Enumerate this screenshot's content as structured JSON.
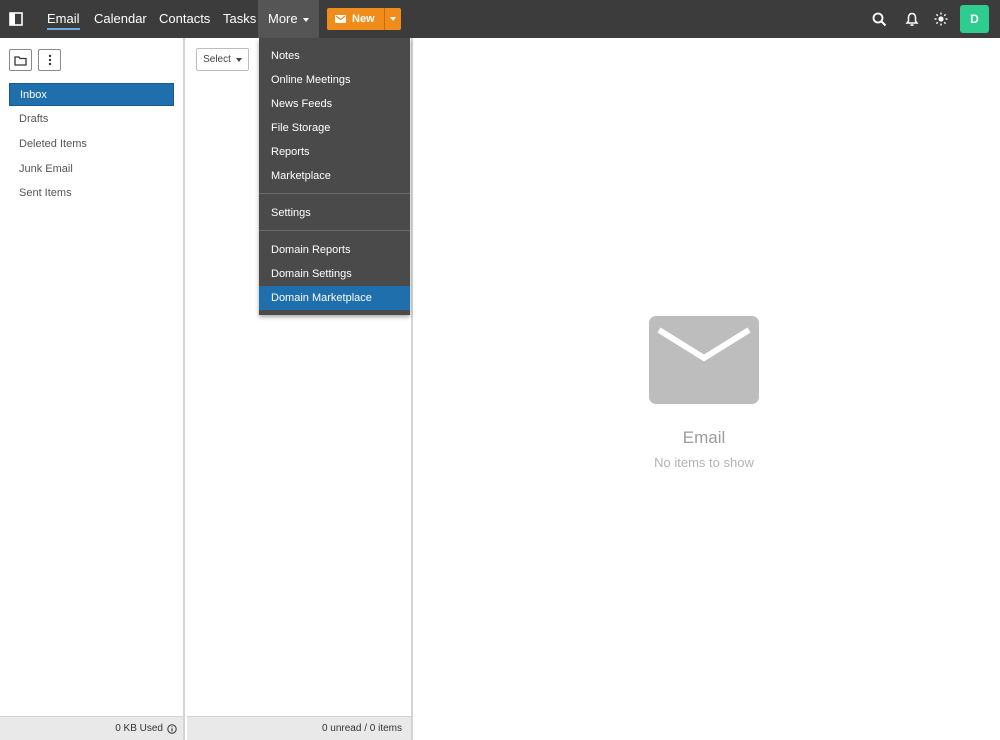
{
  "topbar": {
    "nav": [
      {
        "label": "Email",
        "active": true
      },
      {
        "label": "Calendar",
        "active": false
      },
      {
        "label": "Contacts",
        "active": false
      },
      {
        "label": "Tasks",
        "active": false
      },
      {
        "label": "More",
        "active": false
      }
    ],
    "new_button_label": "New",
    "avatar_initial": "D",
    "icons": [
      "panel-toggle-icon",
      "search-icon",
      "bell-icon",
      "sun-icon"
    ]
  },
  "folders": {
    "items": [
      {
        "label": "Inbox",
        "selected": true
      },
      {
        "label": "Drafts",
        "selected": false
      },
      {
        "label": "Deleted Items",
        "selected": false
      },
      {
        "label": "Junk Email",
        "selected": false
      },
      {
        "label": "Sent Items",
        "selected": false
      }
    ],
    "footer": "0 KB Used"
  },
  "message_list": {
    "select_label": "Select",
    "footer": "0 unread / 0 items"
  },
  "more_menu": {
    "group1": [
      "Notes",
      "Online Meetings",
      "News Feeds",
      "File Storage",
      "Reports",
      "Marketplace"
    ],
    "group2": [
      "Settings"
    ],
    "group3": [
      "Domain Reports",
      "Domain Settings",
      "Domain Marketplace"
    ],
    "highlighted": "Domain Marketplace"
  },
  "reading_pane": {
    "title": "Email",
    "subtitle": "No items to show"
  },
  "colors": {
    "topbar": "#3c3c3c",
    "accent_blue": "#1f6fad",
    "new_orange": "#ef8c1a",
    "avatar_green": "#2ecc8f"
  }
}
